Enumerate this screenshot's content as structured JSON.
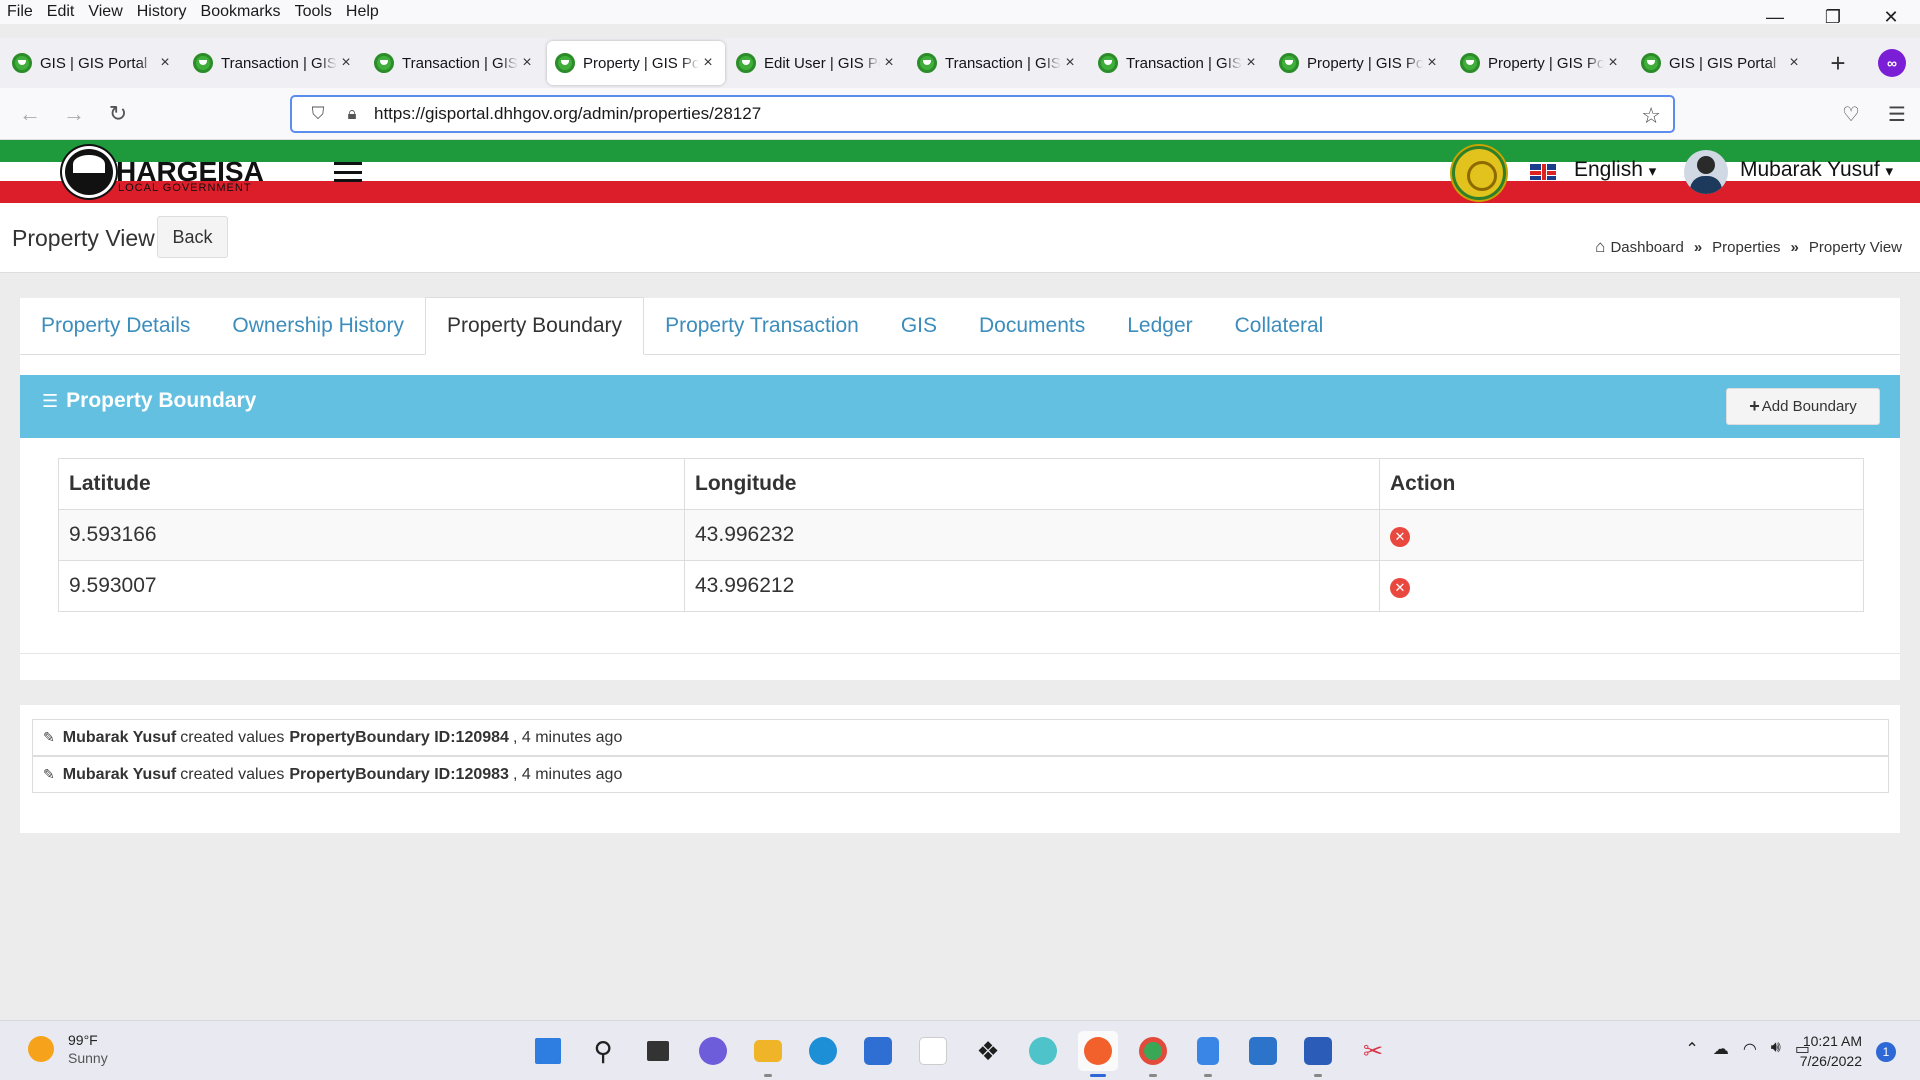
{
  "browser": {
    "menu": [
      "File",
      "Edit",
      "View",
      "History",
      "Bookmarks",
      "Tools",
      "Help"
    ],
    "window_controls": {
      "minimize": "—",
      "restore": "❐",
      "close": "✕"
    },
    "tabs": [
      {
        "label": "GIS | GIS Portal",
        "active": false
      },
      {
        "label": "Transaction | GIS Portal",
        "active": false
      },
      {
        "label": "Transaction | GIS Portal",
        "active": false
      },
      {
        "label": "Property | GIS Portal",
        "active": true
      },
      {
        "label": "Edit User | GIS Portal",
        "active": false
      },
      {
        "label": "Transaction | GIS Portal",
        "active": false
      },
      {
        "label": "Transaction | GIS Portal",
        "active": false
      },
      {
        "label": "Property | GIS Portal",
        "active": false
      },
      {
        "label": "Property | GIS Portal",
        "active": false
      },
      {
        "label": "GIS | GIS Portal",
        "active": false
      }
    ],
    "tab_close": "×",
    "new_tab": "+",
    "url": "https://gisportal.dhhgov.org/admin/properties/28127"
  },
  "header": {
    "logo_text": "HARGEISA",
    "logo_subtext": "LOCAL GOVERNMENT",
    "language": "English",
    "user_name": "Mubarak Yusuf",
    "caret": "▾"
  },
  "page": {
    "title": "Property View",
    "back_label": "Back",
    "breadcrumb": [
      "Dashboard",
      "Properties",
      "Property View"
    ],
    "breadcrumb_sep": "»"
  },
  "tabs": [
    {
      "label": "Property Details",
      "active": false
    },
    {
      "label": "Ownership History",
      "active": false
    },
    {
      "label": "Property Boundary",
      "active": true
    },
    {
      "label": "Property Transaction",
      "active": false
    },
    {
      "label": "GIS",
      "active": false
    },
    {
      "label": "Documents",
      "active": false
    },
    {
      "label": "Ledger",
      "active": false
    },
    {
      "label": "Collateral",
      "active": false
    }
  ],
  "panel": {
    "title": "Property Boundary",
    "add_label": "Add Boundary"
  },
  "table": {
    "headers": [
      "Latitude",
      "Longitude",
      "Action"
    ],
    "rows": [
      {
        "lat": "9.593166",
        "lng": "43.996232"
      },
      {
        "lat": "9.593007",
        "lng": "43.996212"
      }
    ]
  },
  "activity": [
    {
      "user": "Mubarak Yusuf",
      "action": "created values",
      "target": "PropertyBoundary ID:120984",
      "time": ", 4 minutes ago"
    },
    {
      "user": "Mubarak Yusuf",
      "action": "created values",
      "target": "PropertyBoundary ID:120983",
      "time": ", 4 minutes ago"
    }
  ],
  "taskbar": {
    "temperature": "99°F",
    "condition": "Sunny",
    "time": "10:21 AM",
    "date": "7/26/2022",
    "notifications": "1"
  },
  "colors": {
    "link": "#3c8dbc",
    "panel_header": "#64c0e0",
    "flag_green": "#1e9a3c",
    "flag_red": "#dc1d2a",
    "delete_icon": "#e8483e"
  }
}
